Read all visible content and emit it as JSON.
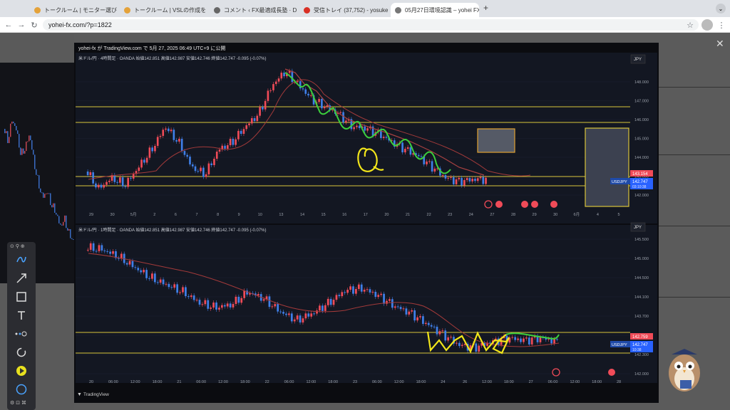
{
  "browser": {
    "tabs": [
      {
        "label": "トークルーム | モニター選びの仕"
      },
      {
        "label": "トークルーム | VSLの作成をお任"
      },
      {
        "label": "コメント ‹ FX最適成長塾 · Dre"
      },
      {
        "label": "受信トレイ (37,752) - yosuke"
      },
      {
        "label": "05月27日環境認識 – yohei FX"
      }
    ],
    "new_tab": "+",
    "url": "yohei-fx.com/?p=1822",
    "close_overlay": "✕"
  },
  "modal": {
    "title": "yohei-fx が TradingView.com で 5月 27, 2025 06:49 UTC+9 に公開",
    "footer_logo": "TradingView"
  },
  "top_chart": {
    "header": "米ドル/円 · 4時間足 · OANDA  始値142.851  高値142.987  安値142.746  終値142.747  -0.095 (-0.07%)",
    "currency": "JPY",
    "price_ticks": [
      "148.000",
      "147.000",
      "146.000",
      "145.000",
      "144.000",
      "143.000",
      "142.000"
    ],
    "price_tag_red": "143.154",
    "symbol": "USDJPY",
    "price_tag_blue": "142.747",
    "countdown": "03:10:38",
    "date_ticks": [
      "29",
      "30",
      "5月",
      "2",
      "6",
      "7",
      "8",
      "9",
      "10",
      "13",
      "14",
      "15",
      "16",
      "17",
      "20",
      "21",
      "22",
      "23",
      "24",
      "27",
      "28",
      "29",
      "30",
      "6月",
      "4",
      "5"
    ]
  },
  "bottom_chart": {
    "header": "米ドル/円 · 1時間足 · OANDA  始値142.851  高値142.987  安値142.746  終値142.747  -0.095 (-0.07%)",
    "currency": "JPY",
    "price_ticks": [
      "145.500",
      "145.000",
      "144.500",
      "144.100",
      "143.700",
      "143.300",
      "142.300",
      "142.000"
    ],
    "price_tag_red": "142.759",
    "symbol": "USDJPY",
    "price_tag_blue": "142.747",
    "countdown": "10:38",
    "date_ticks": [
      "20",
      "06:00",
      "12:00",
      "18:00",
      "21",
      "06:00",
      "12:00",
      "18:00",
      "22",
      "06:00",
      "12:00",
      "18:00",
      "23",
      "06:00",
      "12:00",
      "18:00",
      "24",
      "26",
      "12:00",
      "18:00",
      "27",
      "06:00",
      "12:00",
      "18:00",
      "28"
    ]
  },
  "colors": {
    "bull": "#f04b58",
    "bear": "#3f7fe8",
    "ma": "#a33a3a",
    "level": "#d9c43a",
    "annotation_yellow": "#f2e61a",
    "annotation_green": "#3ccf3c"
  },
  "toolbar": {
    "icons": [
      "wave-pen-icon",
      "arrow-tool-icon",
      "rectangle-tool-icon",
      "text-tool-icon",
      "dots-tool-icon",
      "refresh-icon",
      "play-icon",
      "spinner-icon"
    ]
  }
}
